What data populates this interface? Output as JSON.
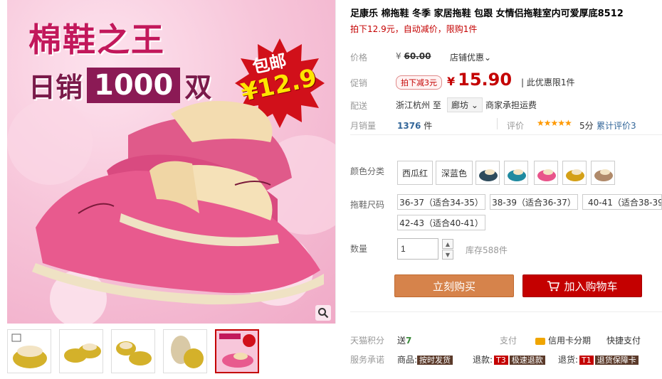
{
  "gallery": {
    "hero_title": "棉鞋之王",
    "hero_sub_prefix": "日销",
    "hero_sub_number": "1000",
    "hero_sub_suffix": "双",
    "starburst_top": "包邮",
    "starburst_price": "¥12.9",
    "zoom_icon": "magnifier-icon",
    "thumbnails": [
      "thumb-yellow-1",
      "thumb-yellow-2",
      "thumb-yellow-3",
      "thumb-sole",
      "thumb-pink-active"
    ]
  },
  "product": {
    "title": "足康乐 棉拖鞋 冬季 家居拖鞋 包跟 女情侣拖鞋室内可爱厚底8512",
    "subtitle": "拍下12.9元，自动减价，限购1件"
  },
  "pricing": {
    "price_label": "价格",
    "original_price_currency": "¥",
    "original_price": "60.00",
    "shop_discount": "店铺优惠⌄",
    "promo_label": "促销",
    "promo_tag": "拍下减3元",
    "promo_currency": "¥",
    "promo_price": "15.90",
    "promo_note": "| 此优惠限1件",
    "shipping_label": "配送",
    "ship_from": "浙江杭州 至",
    "ship_dest": "廊坊 ⌄",
    "ship_fee": "商家承担运费"
  },
  "sales": {
    "monthly_label": "月销量",
    "monthly_value": "1376",
    "monthly_unit": "件",
    "review_label": "评价",
    "stars": "★★★★★",
    "score": "5分",
    "review_link": "累计评价3"
  },
  "sku": {
    "color_label": "颜色分类",
    "color_options": [
      "西瓜红",
      "深蓝色"
    ],
    "swatch_colors": [
      "#2e4b5c",
      "#1f8aa0",
      "#e8548a",
      "#d4a017",
      "#b08a6a"
    ],
    "size_label": "拖鞋尺码",
    "size_options": [
      "36-37（适合34-35）",
      "38-39（适合36-37）",
      "40-41（适合38-39）",
      "42-43（适合40-41）"
    ],
    "qty_label": "数量",
    "qty_value": "1",
    "stock_text": "库存588件"
  },
  "actions": {
    "buy_now": "立刻购买",
    "add_to_cart": "加入购物车"
  },
  "footer": {
    "points_label": "天猫积分",
    "points_prefix": "送",
    "points_value": "7",
    "pay_label": "支付",
    "pay_credit": "信用卡分期",
    "pay_quick": "快捷支付",
    "service_label": "服务承诺",
    "service_goods": "商品:",
    "service_goods_tag": "按时发货",
    "service_refund": "退款:",
    "service_refund_badge": "T3",
    "service_refund_tag": "极速退款",
    "service_return": "退货:",
    "service_return_badge": "T1",
    "service_return_tag": "退货保障卡"
  }
}
